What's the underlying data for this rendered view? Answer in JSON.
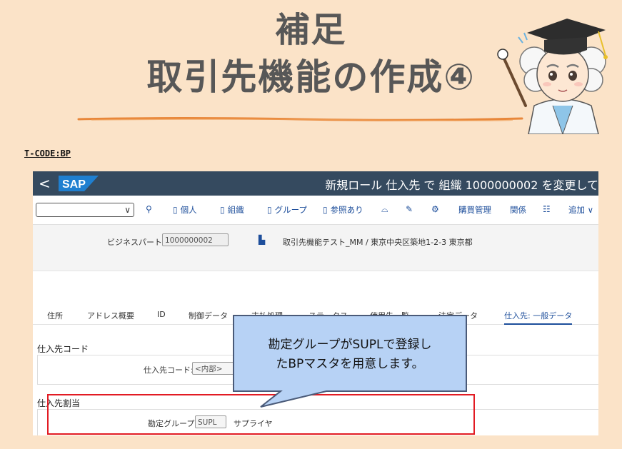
{
  "slide": {
    "title_line1": "補足",
    "title_line2": "取引先機能の作成④",
    "tcode": "T-CODE:BP"
  },
  "sap": {
    "back": "<",
    "logo_text": "SAP",
    "window_title": "新規ロール 仕入先 で 組織 1000000002 を変更して",
    "toolbar": {
      "items": [
        {
          "label": "",
          "icon": "person-add-icon",
          "glyph": "⚲"
        },
        {
          "label": "個人",
          "icon": "document-icon",
          "glyph": "▯"
        },
        {
          "label": "組織",
          "icon": "document-icon",
          "glyph": "▯"
        },
        {
          "label": "グループ",
          "icon": "document-icon",
          "glyph": "▯"
        },
        {
          "label": "参照あり",
          "icon": "document-icon",
          "glyph": "▯"
        },
        {
          "label": "",
          "icon": "chat-icon",
          "glyph": "⌓"
        },
        {
          "label": "",
          "icon": "edit-icon",
          "glyph": "✎"
        },
        {
          "label": "",
          "icon": "settings-icon",
          "glyph": "⚙"
        },
        {
          "label": "購買管理",
          "icon": "",
          "glyph": ""
        },
        {
          "label": "関係",
          "icon": "",
          "glyph": ""
        },
        {
          "label": "",
          "icon": "list-icon",
          "glyph": "☷"
        },
        {
          "label": "追加",
          "icon": "chevron-down-icon",
          "glyph": "∨"
        }
      ]
    },
    "header": {
      "bp_label": "ビジネスパートナ",
      "bp_value": "1000000002",
      "bp_desc": "取引先機能テスト_MM / 東京中央区築地1-2-3 東京都"
    },
    "tabs": [
      {
        "label": "住所"
      },
      {
        "label": "アドレス概要"
      },
      {
        "label": "ID"
      },
      {
        "label": "制御データ"
      },
      {
        "label": "支払処理"
      },
      {
        "label": "ステータス"
      },
      {
        "label": "使用先一覧"
      },
      {
        "label": "法定データ"
      },
      {
        "label": "仕入先: 一般データ",
        "active": true
      }
    ],
    "vendor_code_section": {
      "title": "仕入先コード",
      "label": "仕入先コード:",
      "value": "<内部>"
    },
    "assignment_section": {
      "title": "仕入先割当",
      "label": "勘定グループ",
      "value": "SUPL",
      "desc": "サプライヤ"
    }
  },
  "callout": {
    "line1": "勘定グループがSUPLで登録し",
    "line2": "たBPマスタを用意します。"
  },
  "colors": {
    "background": "#fbe3c8",
    "shell": "#354a5f",
    "highlight": "#e21b23",
    "callout_fill": "#b7d2f5",
    "callout_border": "#4a5a78"
  }
}
